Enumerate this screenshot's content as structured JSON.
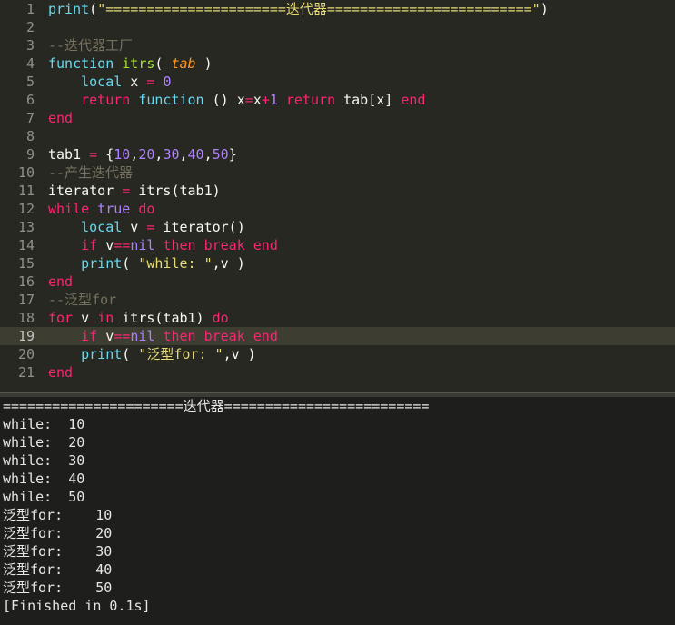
{
  "editor": {
    "line_numbers": [
      "1",
      "2",
      "3",
      "4",
      "5",
      "6",
      "7",
      "8",
      "9",
      "10",
      "11",
      "12",
      "13",
      "14",
      "15",
      "16",
      "17",
      "18",
      "19",
      "20",
      "21"
    ],
    "current_line": "19",
    "lines": [
      [
        {
          "t": "print",
          "c": "fn"
        },
        {
          "t": "(",
          "c": ""
        },
        {
          "t": "\"======================迭代器=========================\"",
          "c": "str"
        },
        {
          "t": ")",
          "c": ""
        }
      ],
      [],
      [
        {
          "t": "--迭代器工厂",
          "c": "cm"
        }
      ],
      [
        {
          "t": "function",
          "c": "fn"
        },
        {
          "t": " ",
          "c": ""
        },
        {
          "t": "itrs",
          "c": "fname"
        },
        {
          "t": "( ",
          "c": ""
        },
        {
          "t": "tab",
          "c": "arg"
        },
        {
          "t": " )",
          "c": ""
        }
      ],
      [
        {
          "t": "    ",
          "c": ""
        },
        {
          "t": "local",
          "c": "fn"
        },
        {
          "t": " x ",
          "c": ""
        },
        {
          "t": "=",
          "c": "op"
        },
        {
          "t": " ",
          "c": ""
        },
        {
          "t": "0",
          "c": "num"
        }
      ],
      [
        {
          "t": "    ",
          "c": ""
        },
        {
          "t": "return",
          "c": "kw"
        },
        {
          "t": " ",
          "c": ""
        },
        {
          "t": "function",
          "c": "fn"
        },
        {
          "t": " () x",
          "c": ""
        },
        {
          "t": "=",
          "c": "op"
        },
        {
          "t": "x",
          "c": ""
        },
        {
          "t": "+",
          "c": "op"
        },
        {
          "t": "1",
          "c": "num"
        },
        {
          "t": " ",
          "c": ""
        },
        {
          "t": "return",
          "c": "kw"
        },
        {
          "t": " tab[x] ",
          "c": ""
        },
        {
          "t": "end",
          "c": "kw"
        }
      ],
      [
        {
          "t": "end",
          "c": "kw"
        }
      ],
      [],
      [
        {
          "t": "tab1 ",
          "c": ""
        },
        {
          "t": "=",
          "c": "op"
        },
        {
          "t": " {",
          "c": ""
        },
        {
          "t": "10",
          "c": "num"
        },
        {
          "t": ",",
          "c": ""
        },
        {
          "t": "20",
          "c": "num"
        },
        {
          "t": ",",
          "c": ""
        },
        {
          "t": "30",
          "c": "num"
        },
        {
          "t": ",",
          "c": ""
        },
        {
          "t": "40",
          "c": "num"
        },
        {
          "t": ",",
          "c": ""
        },
        {
          "t": "50",
          "c": "num"
        },
        {
          "t": "}",
          "c": ""
        }
      ],
      [
        {
          "t": "--产生迭代器",
          "c": "cm"
        }
      ],
      [
        {
          "t": "iterator ",
          "c": ""
        },
        {
          "t": "=",
          "c": "op"
        },
        {
          "t": " itrs(tab1)",
          "c": ""
        }
      ],
      [
        {
          "t": "while",
          "c": "kw"
        },
        {
          "t": " ",
          "c": ""
        },
        {
          "t": "true",
          "c": "num"
        },
        {
          "t": " ",
          "c": ""
        },
        {
          "t": "do",
          "c": "kw"
        }
      ],
      [
        {
          "t": "    ",
          "c": ""
        },
        {
          "t": "local",
          "c": "fn"
        },
        {
          "t": " v ",
          "c": ""
        },
        {
          "t": "=",
          "c": "op"
        },
        {
          "t": " iterator()",
          "c": ""
        }
      ],
      [
        {
          "t": "    ",
          "c": ""
        },
        {
          "t": "if",
          "c": "kw"
        },
        {
          "t": " v",
          "c": ""
        },
        {
          "t": "==",
          "c": "op"
        },
        {
          "t": "nil",
          "c": "num"
        },
        {
          "t": " ",
          "c": ""
        },
        {
          "t": "then",
          "c": "kw"
        },
        {
          "t": " ",
          "c": ""
        },
        {
          "t": "break",
          "c": "kw"
        },
        {
          "t": " ",
          "c": ""
        },
        {
          "t": "end",
          "c": "kw"
        }
      ],
      [
        {
          "t": "    ",
          "c": ""
        },
        {
          "t": "print",
          "c": "fn"
        },
        {
          "t": "( ",
          "c": ""
        },
        {
          "t": "\"while: \"",
          "c": "str"
        },
        {
          "t": ",v )",
          "c": ""
        }
      ],
      [
        {
          "t": "end",
          "c": "kw"
        }
      ],
      [
        {
          "t": "--泛型for",
          "c": "cm"
        }
      ],
      [
        {
          "t": "for",
          "c": "kw"
        },
        {
          "t": " v ",
          "c": ""
        },
        {
          "t": "in",
          "c": "kw"
        },
        {
          "t": " itrs(tab1) ",
          "c": ""
        },
        {
          "t": "do",
          "c": "kw"
        }
      ],
      [
        {
          "t": "    ",
          "c": ""
        },
        {
          "t": "if",
          "c": "kw"
        },
        {
          "t": " v",
          "c": ""
        },
        {
          "t": "==",
          "c": "op"
        },
        {
          "t": "nil",
          "c": "num"
        },
        {
          "t": " ",
          "c": ""
        },
        {
          "t": "then",
          "c": "kw"
        },
        {
          "t": " ",
          "c": ""
        },
        {
          "t": "break",
          "c": "kw"
        },
        {
          "t": " ",
          "c": ""
        },
        {
          "t": "end",
          "c": "kw"
        }
      ],
      [
        {
          "t": "    ",
          "c": ""
        },
        {
          "t": "print",
          "c": "fn"
        },
        {
          "t": "( ",
          "c": ""
        },
        {
          "t": "\"泛型for: \"",
          "c": "str"
        },
        {
          "t": ",v )",
          "c": ""
        }
      ],
      [
        {
          "t": "end",
          "c": "kw"
        }
      ]
    ]
  },
  "console": {
    "lines": [
      "======================迭代器=========================",
      "while:  10",
      "while:  20",
      "while:  30",
      "while:  40",
      "while:  50",
      "泛型for:    10",
      "泛型for:    20",
      "泛型for:    30",
      "泛型for:    40",
      "泛型for:    50",
      "[Finished in 0.1s]"
    ]
  },
  "colors": {
    "editor_bg": "#272822",
    "console_bg": "#1e1f1c",
    "keyword": "#f92672",
    "builtin": "#66d9ef",
    "function_name": "#a6e22e",
    "argument": "#fd971f",
    "number": "#ae81ff",
    "string": "#e6db74",
    "comment": "#75715e"
  }
}
